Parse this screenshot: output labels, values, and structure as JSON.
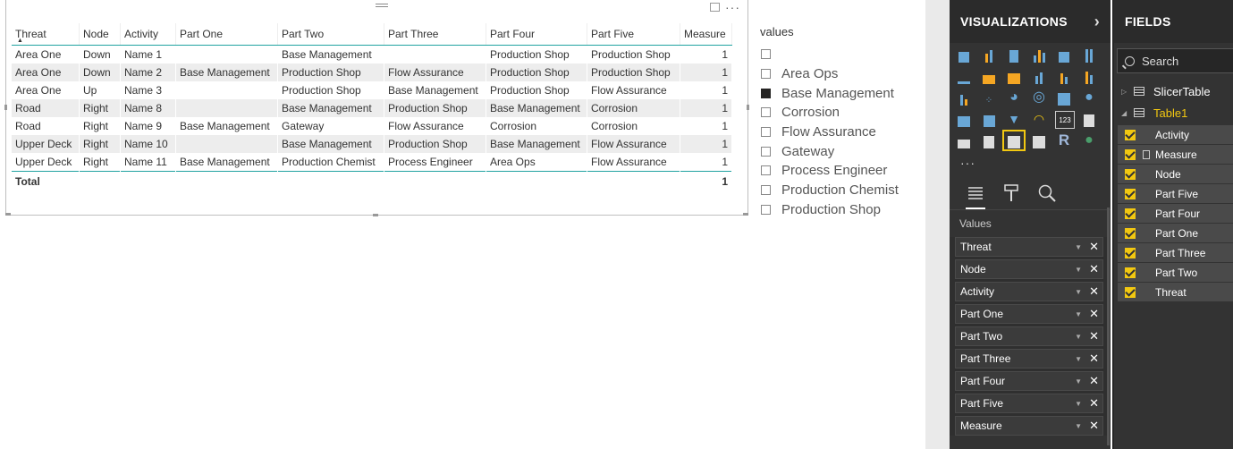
{
  "table": {
    "columns": [
      "Threat",
      "Node",
      "Activity",
      "Part One",
      "Part Two",
      "Part Three",
      "Part Four",
      "Part Five",
      "Measure"
    ],
    "rows": [
      [
        "Area One",
        "Down",
        "Name 1",
        "",
        "Base Management",
        "",
        "Production Shop",
        "Production Shop",
        "1"
      ],
      [
        "Area One",
        "Down",
        "Name 2",
        "Base Management",
        "Production Shop",
        "Flow Assurance",
        "Production Shop",
        "Production Shop",
        "1"
      ],
      [
        "Area One",
        "Up",
        "Name 3",
        "",
        "Production Shop",
        "Base Management",
        "Production Shop",
        "Flow Assurance",
        "1"
      ],
      [
        "Road",
        "Right",
        "Name 8",
        "",
        "Base Management",
        "Production Shop",
        "Base Management",
        "Corrosion",
        "1"
      ],
      [
        "Road",
        "Right",
        "Name 9",
        "Base Management",
        "Gateway",
        "Flow Assurance",
        "Corrosion",
        "Corrosion",
        "1"
      ],
      [
        "Upper Deck",
        "Right",
        "Name 10",
        "",
        "Base Management",
        "Production Shop",
        "Base Management",
        "Flow Assurance",
        "1"
      ],
      [
        "Upper Deck",
        "Right",
        "Name 11",
        "Base Management",
        "Production Chemist",
        "Process Engineer",
        "Area Ops",
        "Flow Assurance",
        "1"
      ]
    ],
    "total_label": "Total",
    "total_value": "1",
    "more_options": "···"
  },
  "slicer": {
    "title": "values",
    "items": [
      {
        "label": "",
        "checked": false
      },
      {
        "label": "Area Ops",
        "checked": false
      },
      {
        "label": "Base Management",
        "checked": true
      },
      {
        "label": "Corrosion",
        "checked": false
      },
      {
        "label": "Flow Assurance",
        "checked": false
      },
      {
        "label": "Gateway",
        "checked": false
      },
      {
        "label": "Process Engineer",
        "checked": false
      },
      {
        "label": "Production Chemist",
        "checked": false
      },
      {
        "label": "Production Shop",
        "checked": false
      }
    ]
  },
  "visualizations": {
    "title": "VISUALIZATIONS",
    "more": "···",
    "values_label": "Values",
    "r_visual_label": "R",
    "card_label": "123",
    "wells": [
      "Threat",
      "Node",
      "Activity",
      "Part One",
      "Part Two",
      "Part Three",
      "Part Four",
      "Part Five",
      "Measure"
    ]
  },
  "fields": {
    "title": "FIELDS",
    "search_placeholder": "Search",
    "tables": [
      {
        "name": "SlicerTable",
        "expanded": false
      },
      {
        "name": "Table1",
        "expanded": true
      }
    ],
    "table1_fields": [
      "Activity",
      "Measure",
      "Node",
      "Part Five",
      "Part Four",
      "Part One",
      "Part Three",
      "Part Two",
      "Threat"
    ]
  },
  "colors": {
    "accent_teal": "#21a3a1",
    "accent_yellow": "#f2c811",
    "pane_dark": "#333333"
  }
}
